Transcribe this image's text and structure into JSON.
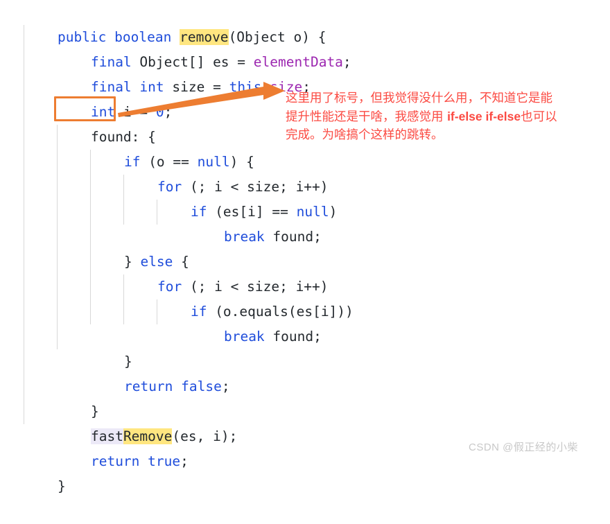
{
  "editor": {
    "language": "java",
    "background": "#ffffff",
    "default_text_color": "#24292e",
    "keyword_color": "#1f4ddb",
    "member_color": "#9c27b0",
    "indent_guide_color": "#d8d8d8",
    "highlight_yellow": "#ffe680",
    "highlight_lavender": "#ece9f7",
    "lines": [
      "public boolean remove(Object o) {",
      "    final Object[] es = elementData;",
      "    final int size = this.size;",
      "    int i = 0;",
      "    found: {",
      "        if (o == null) {",
      "            for (; i < size; i++)",
      "                if (es[i] == null)",
      "                    break found;",
      "        } else {",
      "            for (; i < size; i++)",
      "                if (o.equals(es[i]))",
      "                    break found;",
      "        }",
      "        return false;",
      "    }",
      "    fastRemove(es, i);",
      "    return true;",
      "}"
    ]
  },
  "tokens": {
    "l1": {
      "t1": "public",
      "t2": " ",
      "t3": "boolean",
      "t4": " ",
      "t5": "remove",
      "t6": "(Object o) {"
    },
    "l2": {
      "t1": "final",
      "t2": " Object[] es = ",
      "t3": "elementData",
      "t4": ";"
    },
    "l3": {
      "t1": "final",
      "t2": " ",
      "t3": "int",
      "t4": " size = ",
      "t5": "this",
      "t6": ".",
      "t7": "size",
      "t8": ";"
    },
    "l4": {
      "t1": "int",
      "t2": " i = ",
      "t3": "0",
      "t4": ";"
    },
    "l5": {
      "t1": "found: {"
    },
    "l6": {
      "t1": "if",
      "t2": " (o == ",
      "t3": "null",
      "t4": ") {"
    },
    "l7": {
      "t1": "for",
      "t2": " (; i < size; i++)"
    },
    "l8": {
      "t1": "if",
      "t2": " (es[i] == ",
      "t3": "null",
      "t4": ")"
    },
    "l9": {
      "t1": "break",
      "t2": " found;"
    },
    "l10": {
      "t1": "} ",
      "t2": "else",
      "t3": " {"
    },
    "l11": {
      "t1": "for",
      "t2": " (; i < size; i++)"
    },
    "l12": {
      "t1": "if",
      "t2": " (o.equals(es[i]))"
    },
    "l13": {
      "t1": "break",
      "t2": " found;"
    },
    "l14": {
      "t1": "}"
    },
    "l15": {
      "t1": "return",
      "t2": " ",
      "t3": "false",
      "t4": ";"
    },
    "l16": {
      "t1": "}"
    },
    "l17": {
      "t1": "fast",
      "t2": "Remove",
      "t3": "(es, i);"
    },
    "l18": {
      "t1": "return",
      "t2": " ",
      "t3": "true",
      "t4": ";"
    },
    "l19": {
      "t1": "}"
    }
  },
  "annotation": {
    "color": "#fb4a42",
    "arrow_color": "#ed7d31",
    "box_color": "#ed7d31",
    "box_target": "found:",
    "line1": "这里用了标号，但我觉得没什么用，不知道它是能",
    "line2_a": "提升性能还是干啥，我感觉用 ",
    "line2_b": "if-else if-else",
    "line2_c": "也可以",
    "line3": "完成。为啥搞个这样的跳转。"
  },
  "watermark": {
    "text": "CSDN @假正经的小柴",
    "color": "#c8c8c8"
  }
}
